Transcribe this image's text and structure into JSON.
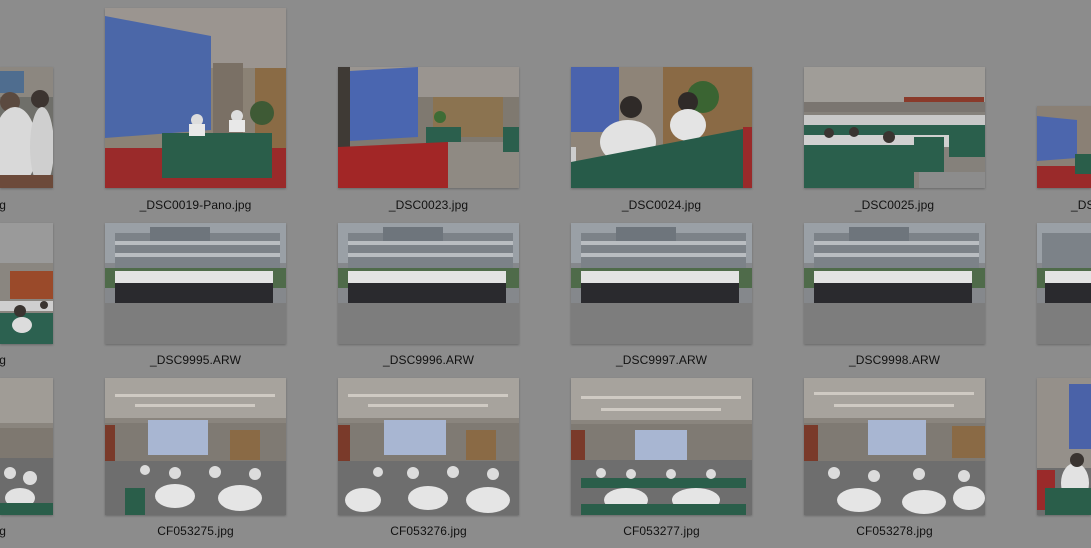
{
  "rows": [
    {
      "files": [
        {
          "name": "jpg",
          "scene": "speaker-close"
        },
        {
          "name": "_DSC0019-Pano.jpg",
          "scene": "stage-screen"
        },
        {
          "name": "_DSC0023.jpg",
          "scene": "stage-wide"
        },
        {
          "name": "_DSC0024.jpg",
          "scene": "speakers-table"
        },
        {
          "name": "_DSC0025.jpg",
          "scene": "audience-rows"
        },
        {
          "name": "_DS",
          "scene": "stage-screen"
        }
      ]
    },
    {
      "files": [
        {
          "name": "g",
          "scene": "audience-desk"
        },
        {
          "name": "_DSC9995.ARW",
          "scene": "group-photo"
        },
        {
          "name": "_DSC9996.ARW",
          "scene": "group-photo"
        },
        {
          "name": "_DSC9997.ARW",
          "scene": "group-photo"
        },
        {
          "name": "_DSC9998.ARW",
          "scene": "group-photo"
        },
        {
          "name": "",
          "scene": "group-photo"
        }
      ]
    },
    {
      "files": [
        {
          "name": "g",
          "scene": "hall"
        },
        {
          "name": "CF053275.jpg",
          "scene": "hall"
        },
        {
          "name": "CF053276.jpg",
          "scene": "hall"
        },
        {
          "name": "CF053277.jpg",
          "scene": "hall"
        },
        {
          "name": "CF053278.jpg",
          "scene": "hall"
        },
        {
          "name": "",
          "scene": "hall-side"
        }
      ]
    }
  ]
}
